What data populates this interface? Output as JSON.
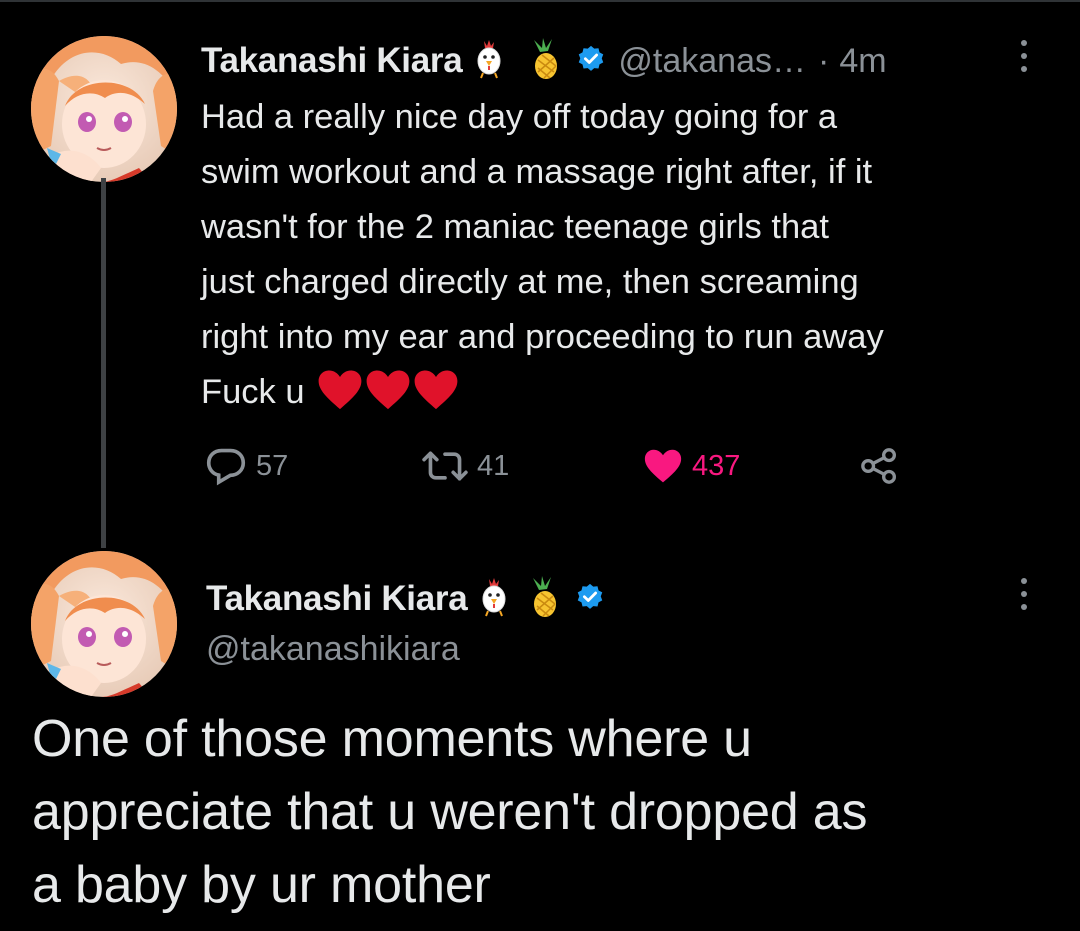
{
  "colors": {
    "background": "#000000",
    "text_primary": "#e7e9ea",
    "text_secondary": "#8b9197",
    "verified": "#1d9bf0",
    "like_pink": "#f91880",
    "heart_red": "#e0122a",
    "thread_line": "#3e4144"
  },
  "tweet1": {
    "display_name": "Takanashi Kiara",
    "name_emojis": [
      "chicken-icon",
      "pineapple-icon"
    ],
    "verified_icon": "verified-badge-icon",
    "handle": "@takanas…",
    "separator": "·",
    "time": "4m",
    "more_icon": "more-vertical-icon",
    "text_lines": [
      "Had a really nice day off today going for a",
      "swim workout and a massage right after, if it",
      "wasn't for the 2 maniac teenage girls that",
      "just charged directly at me, then screaming",
      "right into my ear and proceeding to run away",
      "Fuck u"
    ],
    "trailing_emojis": [
      "red-heart-icon",
      "red-heart-icon",
      "red-heart-icon"
    ],
    "actions": {
      "reply": {
        "icon": "reply-icon",
        "count": "57"
      },
      "retweet": {
        "icon": "retweet-icon",
        "count": "41"
      },
      "like": {
        "icon": "heart-filled-icon",
        "count": "437",
        "liked": true
      },
      "share": {
        "icon": "share-icon"
      }
    }
  },
  "tweet2": {
    "display_name": "Takanashi Kiara",
    "name_emojis": [
      "chicken-icon",
      "pineapple-icon"
    ],
    "verified_icon": "verified-badge-icon",
    "handle": "@takanashikiara",
    "more_icon": "more-vertical-icon",
    "text_lines": [
      "One of those moments where u",
      "appreciate that u weren't dropped as",
      "a baby by ur mother"
    ]
  }
}
